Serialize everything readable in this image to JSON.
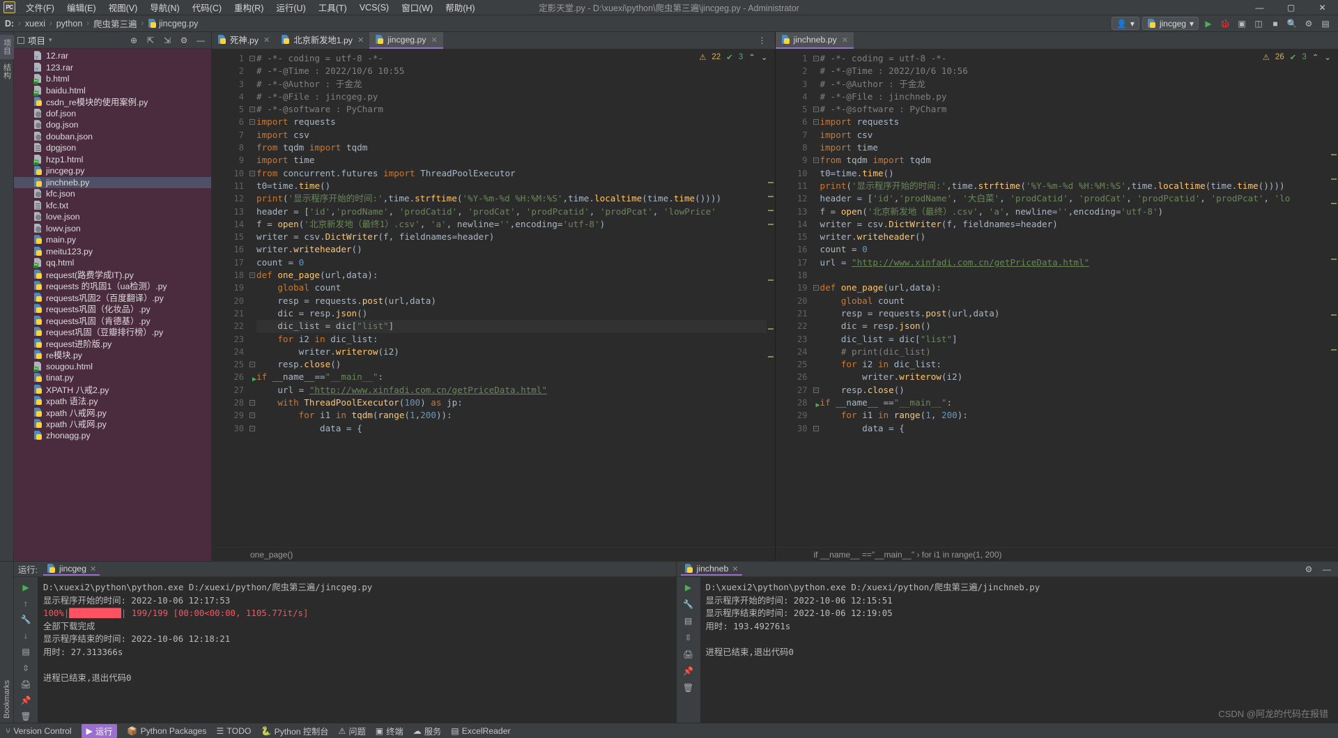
{
  "window": {
    "title": "定影天堂.py - D:\\xuexi\\python\\爬虫第三遍\\jincgeg.py - Administrator",
    "minimize": "—",
    "maximize": "▢",
    "close": "✕"
  },
  "menu": [
    {
      "label": "文件(F)"
    },
    {
      "label": "编辑(E)"
    },
    {
      "label": "视图(V)"
    },
    {
      "label": "导航(N)"
    },
    {
      "label": "代码(C)"
    },
    {
      "label": "重构(R)"
    },
    {
      "label": "运行(U)"
    },
    {
      "label": "工具(T)"
    },
    {
      "label": "VCS(S)"
    },
    {
      "label": "窗口(W)"
    },
    {
      "label": "帮助(H)"
    }
  ],
  "breadcrumb": {
    "drive": "D:",
    "parts": [
      "xuexi",
      "python",
      "爬虫第三遍",
      "jincgeg.py"
    ],
    "sep": "›"
  },
  "toolbar": {
    "run_config": "jincgeg",
    "run_config_chevron": "▾",
    "profile_icon": "👤",
    "profile_chevron": "▾",
    "run_icon": "▶",
    "debug_icon": "🐞",
    "stop_icon": "■",
    "coverage_icon": "▣",
    "profiler_icon": "◫",
    "search_icon": "🔍",
    "settings_icon": "⚙",
    "layout_icon": "▤"
  },
  "sidebar_tabs": [
    {
      "label": "项目",
      "selected": true
    },
    {
      "label": "结构",
      "selected": false
    }
  ],
  "project": {
    "title": "项目",
    "chevron": "▾",
    "tools": [
      "target-icon",
      "collapse-icon",
      "expand-icon",
      "gear-icon",
      "hide-icon"
    ],
    "files": [
      {
        "name": "12.rar",
        "kind": "rar"
      },
      {
        "name": "123.rar",
        "kind": "rar"
      },
      {
        "name": "b.html",
        "kind": "html"
      },
      {
        "name": "baidu.html",
        "kind": "html"
      },
      {
        "name": "csdn_re模块的使用案例.py",
        "kind": "py"
      },
      {
        "name": "dof.json",
        "kind": "json"
      },
      {
        "name": "dog.json",
        "kind": "json"
      },
      {
        "name": "douban.json",
        "kind": "json"
      },
      {
        "name": "dpgjson",
        "kind": "txt"
      },
      {
        "name": "hzp1.html",
        "kind": "html"
      },
      {
        "name": "jincgeg.py",
        "kind": "py"
      },
      {
        "name": "jinchneb.py",
        "kind": "py",
        "selected": true
      },
      {
        "name": "kfc.json",
        "kind": "json"
      },
      {
        "name": "kfc.txt",
        "kind": "txt"
      },
      {
        "name": "love.json",
        "kind": "json"
      },
      {
        "name": "lowv.json",
        "kind": "json"
      },
      {
        "name": "main.py",
        "kind": "py"
      },
      {
        "name": "meitu123.py",
        "kind": "py"
      },
      {
        "name": "qq.html",
        "kind": "html"
      },
      {
        "name": "request(路费学成IT).py",
        "kind": "py"
      },
      {
        "name": "requests 的巩固1（ua检测）.py",
        "kind": "py"
      },
      {
        "name": "requests巩固2（百度翻译）.py",
        "kind": "py"
      },
      {
        "name": "requests巩固（化妆品）.py",
        "kind": "py"
      },
      {
        "name": "requests巩固（肯德基）.py",
        "kind": "py"
      },
      {
        "name": "request巩固（豆瓣排行榜）.py",
        "kind": "py"
      },
      {
        "name": "request进阶版.py",
        "kind": "py"
      },
      {
        "name": "re模块.py",
        "kind": "py"
      },
      {
        "name": "sougou.html",
        "kind": "html"
      },
      {
        "name": "tinat.py",
        "kind": "py"
      },
      {
        "name": "XPATH 八戒2.py",
        "kind": "py"
      },
      {
        "name": "xpath 语法.py",
        "kind": "py"
      },
      {
        "name": "xpath 八戒网.py",
        "kind": "py"
      },
      {
        "name": "xpath  八戒网.py",
        "kind": "py"
      },
      {
        "name": "zhonagg.py",
        "kind": "py"
      }
    ]
  },
  "editor_left": {
    "tabs": [
      {
        "label": "死神.py",
        "active": false,
        "close": "✕"
      },
      {
        "label": "北京新发地1.py",
        "active": false,
        "close": "✕"
      },
      {
        "label": "jincgeg.py",
        "active": true,
        "close": "✕"
      }
    ],
    "inspection": {
      "warnings": "22",
      "warn_icon": "⚠",
      "ok": "3",
      "ok_icon": "✔",
      "chevron": "⌃",
      "chevron2": "⌄"
    },
    "breadcrumb": "one_page()",
    "lines": [
      {
        "n": 1,
        "text": "# -*- coding = utf-8 -*-"
      },
      {
        "n": 2,
        "text": "# -*-@Time : 2022/10/6 10:55"
      },
      {
        "n": 3,
        "text": "# -*-@Author : 于金龙"
      },
      {
        "n": 4,
        "text": "# -*-@File : jincgeg.py"
      },
      {
        "n": 5,
        "text": "# -*-@software : PyCharm"
      },
      {
        "n": 6,
        "text": "import requests"
      },
      {
        "n": 7,
        "text": "import csv"
      },
      {
        "n": 8,
        "text": "from tqdm import tqdm"
      },
      {
        "n": 9,
        "text": "import time"
      },
      {
        "n": 10,
        "text": "from concurrent.futures import ThreadPoolExecutor"
      },
      {
        "n": 11,
        "text": "t0=time.time()"
      },
      {
        "n": 12,
        "text": "print('显示程序开始的时间:',time.strftime('%Y-%m-%d %H:%M:%S',time.localtime(time.time())))"
      },
      {
        "n": 13,
        "text": "header = ['id','prodName', 'prodCatid', 'prodCat', 'prodPcatid', 'prodPcat', 'lowPrice'"
      },
      {
        "n": 14,
        "text": "f = open('北京新发地（最终1）.csv', 'a', newline='',encoding='utf-8')"
      },
      {
        "n": 15,
        "text": "writer = csv.DictWriter(f, fieldnames=header)"
      },
      {
        "n": 16,
        "text": "writer.writeheader()"
      },
      {
        "n": 17,
        "text": "count = 0"
      },
      {
        "n": 18,
        "text": "def one_page(url,data):"
      },
      {
        "n": 19,
        "text": "    global count"
      },
      {
        "n": 20,
        "text": "    resp = requests.post(url,data)"
      },
      {
        "n": 21,
        "text": "    dic = resp.json()"
      },
      {
        "n": 22,
        "text": "    dic_list = dic[\"list\"]"
      },
      {
        "n": 23,
        "text": "    for i2 in dic_list:"
      },
      {
        "n": 24,
        "text": "        writer.writerow(i2)"
      },
      {
        "n": 25,
        "text": "    resp.close()"
      },
      {
        "n": 26,
        "text": "if __name__==\"__main__\":"
      },
      {
        "n": 27,
        "text": "    url = \"http://www.xinfadi.com.cn/getPriceData.html\""
      },
      {
        "n": 28,
        "text": "    with ThreadPoolExecutor(100) as jp:"
      },
      {
        "n": 29,
        "text": "        for i1 in tqdm(range(1,200)):"
      },
      {
        "n": 30,
        "text": "            data = {"
      }
    ]
  },
  "editor_right": {
    "tabs": [
      {
        "label": "jinchneb.py",
        "active": true,
        "close": "✕"
      }
    ],
    "inspection": {
      "warnings": "26",
      "warn_icon": "⚠",
      "ok": "3",
      "ok_icon": "✔",
      "chevron": "⌃",
      "chevron2": "⌄"
    },
    "breadcrumb": "if __name__ ==\"__main__\"  ›  for i1 in range(1, 200)",
    "lines": [
      {
        "n": 1,
        "text": "# -*- coding = utf-8 -*-"
      },
      {
        "n": 2,
        "text": "# -*-@Time : 2022/10/6 10:56"
      },
      {
        "n": 3,
        "text": "# -*-@Author : 于金龙"
      },
      {
        "n": 4,
        "text": "# -*-@File : jinchneb.py"
      },
      {
        "n": 5,
        "text": "# -*-@software : PyCharm"
      },
      {
        "n": 6,
        "text": "import requests"
      },
      {
        "n": 7,
        "text": "import csv"
      },
      {
        "n": 8,
        "text": "import time"
      },
      {
        "n": 9,
        "text": "from tqdm import tqdm"
      },
      {
        "n": 10,
        "text": "t0=time.time()"
      },
      {
        "n": 11,
        "text": "print('显示程序开始的时间:',time.strftime('%Y-%m-%d %H:%M:%S',time.localtime(time.time())))"
      },
      {
        "n": 12,
        "text": "header = ['id','prodName', '大白菜', 'prodCatid', 'prodCat', 'prodPcatid', 'prodPcat', 'lo"
      },
      {
        "n": 13,
        "text": "f = open('北京新发地（最终）.csv', 'a', newline='',encoding='utf-8')"
      },
      {
        "n": 14,
        "text": "writer = csv.DictWriter(f, fieldnames=header)"
      },
      {
        "n": 15,
        "text": "writer.writeheader()"
      },
      {
        "n": 16,
        "text": "count = 0"
      },
      {
        "n": 17,
        "text": "url = \"http://www.xinfadi.com.cn/getPriceData.html\""
      },
      {
        "n": 18,
        "text": ""
      },
      {
        "n": 19,
        "text": "def one_page(url,data):"
      },
      {
        "n": 20,
        "text": "    global count"
      },
      {
        "n": 21,
        "text": "    resp = requests.post(url,data)"
      },
      {
        "n": 22,
        "text": "    dic = resp.json()"
      },
      {
        "n": 23,
        "text": "    dic_list = dic[\"list\"]"
      },
      {
        "n": 24,
        "text": "    # print(dic_list)"
      },
      {
        "n": 25,
        "text": "    for i2 in dic_list:"
      },
      {
        "n": 26,
        "text": "        writer.writerow(i2)"
      },
      {
        "n": 27,
        "text": "    resp.close()"
      },
      {
        "n": 28,
        "text": "if __name__ ==\"__main__\":"
      },
      {
        "n": 29,
        "text": "    for i1 in range(1, 200):"
      },
      {
        "n": 30,
        "text": "        data = {"
      }
    ]
  },
  "run_left": {
    "label": "运行:",
    "tab": "jincgeg",
    "tab_close": "✕",
    "gutter_icons": [
      "▶",
      "↑",
      "🔧",
      "↓",
      "▤",
      "⇳",
      "🖨",
      "📌",
      "🗑"
    ],
    "output": [
      {
        "text": "D:\\xuexi2\\python\\python.exe D:/xuexi/python/爬虫第三遍/jincgeg.py",
        "style": "normal"
      },
      {
        "text": "显示程序开始的时间: 2022-10-06 12:17:53",
        "style": "normal"
      },
      {
        "text": "100%|██████████| 199/199 [00:00<00:00, 1105.77it/s]",
        "style": "red"
      },
      {
        "text": "全部下载完成",
        "style": "normal"
      },
      {
        "text": "显示程序结束的时间: 2022-10-06 12:18:21",
        "style": "normal"
      },
      {
        "text": "用时: 27.313366s",
        "style": "normal"
      },
      {
        "text": "",
        "style": "normal"
      },
      {
        "text": "进程已结束,退出代码0",
        "style": "normal"
      }
    ]
  },
  "run_right": {
    "tab": "jinchneb",
    "tab_close": "✕",
    "gutter_icons": [
      "▶",
      "🔧",
      "▤",
      "⇳",
      "🖨",
      "📌",
      "🗑"
    ],
    "output": [
      {
        "text": "D:\\xuexi2\\python\\python.exe D:/xuexi/python/爬虫第三遍/jinchneb.py",
        "style": "normal"
      },
      {
        "text": "显示程序开始的时间: 2022-10-06 12:15:51",
        "style": "normal"
      },
      {
        "text": "显示程序结束的时间: 2022-10-06 12:19:05",
        "style": "normal"
      },
      {
        "text": "用时: 193.492761s",
        "style": "normal"
      },
      {
        "text": "",
        "style": "normal"
      },
      {
        "text": "进程已结束,退出代码0",
        "style": "normal"
      }
    ]
  },
  "statusbar": {
    "items": [
      {
        "icon": "⑂",
        "label": "Version Control"
      },
      {
        "icon": "▶",
        "label": "运行"
      },
      {
        "icon": "📦",
        "label": "Python Packages"
      },
      {
        "icon": "☰",
        "label": "TODO"
      },
      {
        "icon": "🐍",
        "label": "Python 控制台"
      },
      {
        "icon": "⚠",
        "label": "问题"
      },
      {
        "icon": "▣",
        "label": "终端"
      },
      {
        "icon": "☁",
        "label": "服务"
      },
      {
        "icon": "▤",
        "label": "ExcelReader"
      }
    ],
    "bookmarks_label": "Bookmarks"
  },
  "watermark": "CSDN @阿龙的代码在报错",
  "colors": {
    "accent": "#9b6fd0",
    "tree_bg": "#4b2c3e",
    "editor_bg": "#2b2b2b",
    "chrome_bg": "#3c3f41",
    "warning": "#d6b25e",
    "ok": "#5aa469"
  }
}
